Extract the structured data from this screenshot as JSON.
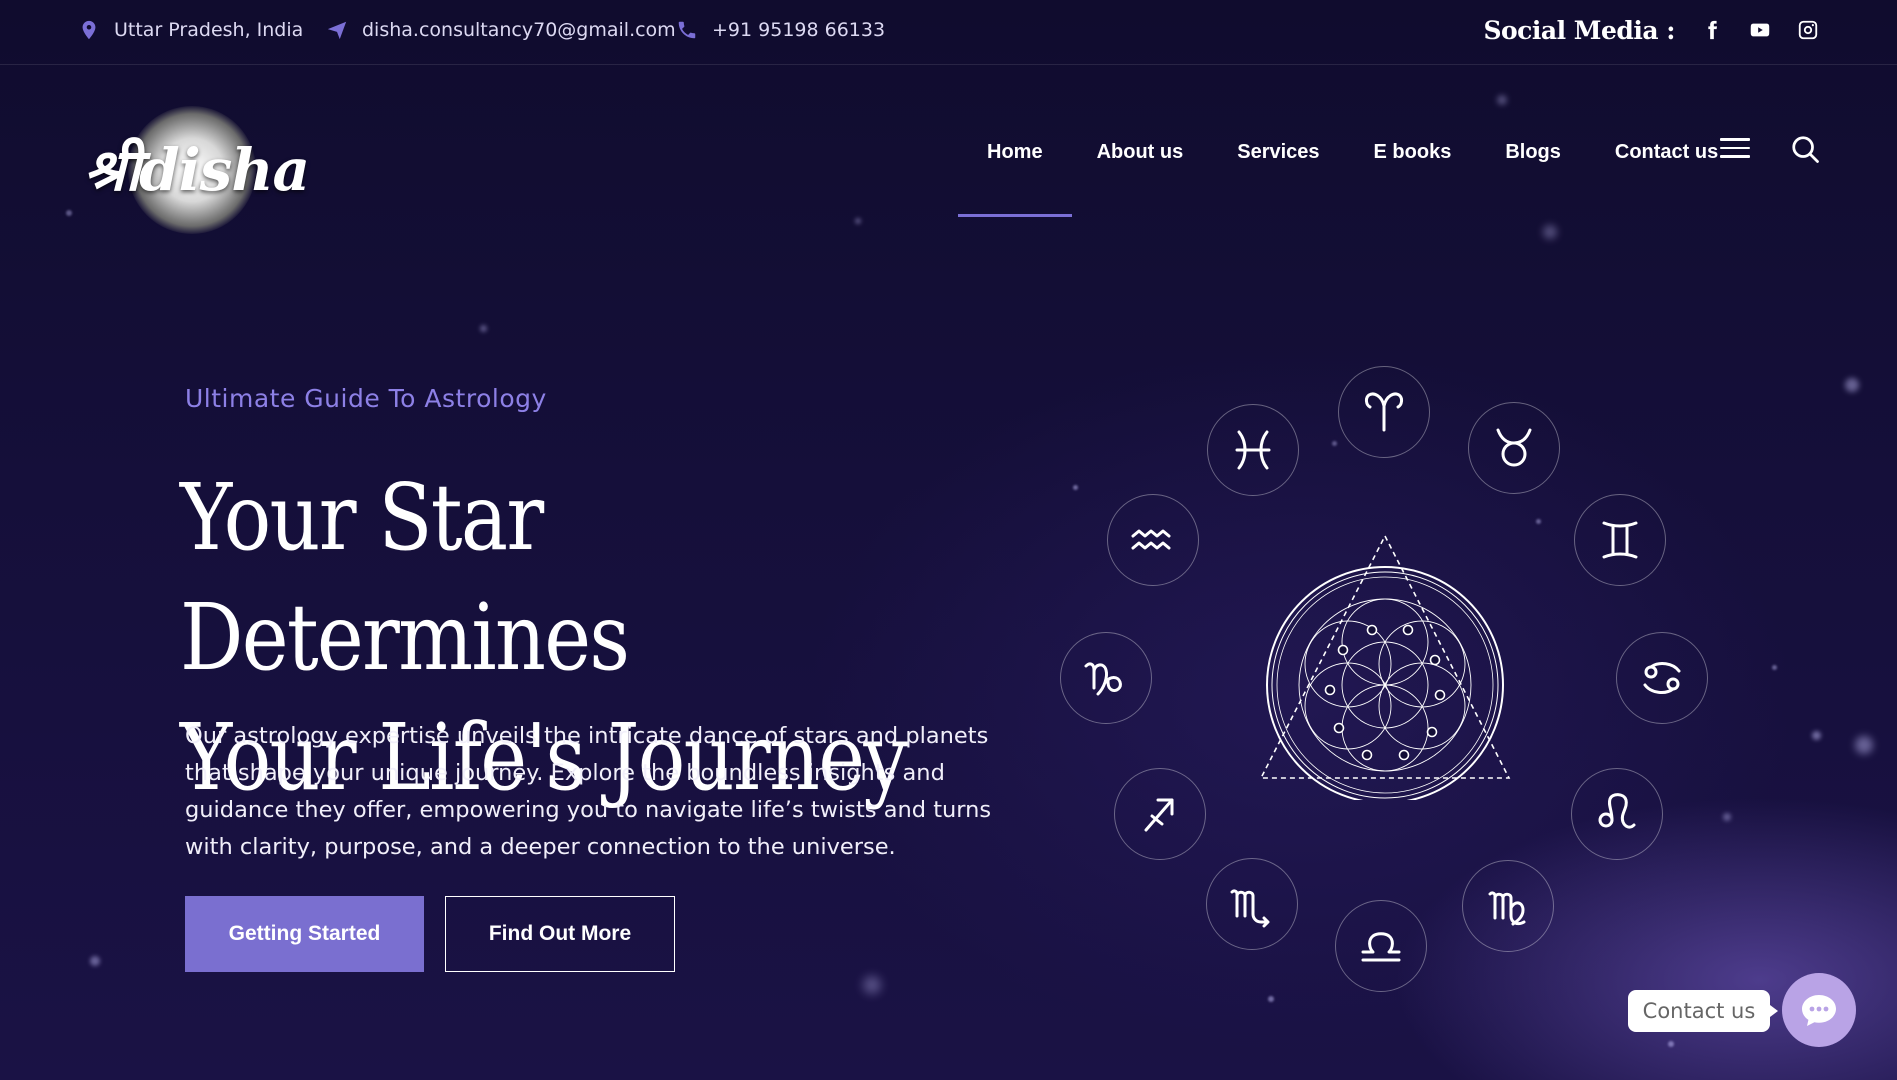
{
  "topbar": {
    "location": "Uttar Pradesh, India",
    "email": "disha.consultancy70@gmail.com",
    "phone": "+91 95198 66133",
    "social_label": "Social Media :",
    "social_icons": [
      "facebook-icon",
      "youtube-icon",
      "instagram-icon"
    ]
  },
  "logo": {
    "text": "श्रीdisha"
  },
  "nav": {
    "items": [
      {
        "label": "Home",
        "active": true
      },
      {
        "label": "About us"
      },
      {
        "label": "Services"
      },
      {
        "label": "E books"
      },
      {
        "label": "Blogs"
      },
      {
        "label": "Contact us"
      }
    ]
  },
  "hero": {
    "eyebrow": "Ultimate Guide To Astrology",
    "headline_line1": "Your Star Determines",
    "headline_line2": "Your Life's Journey",
    "body": "Our astrology expertise unveils the intricate dance of stars and planets that shape your unique journey. Explore the boundless insights and guidance they offer, empowering you to navigate life’s twists and turns with clarity, purpose, and a deeper connection to the universe.",
    "primary_button": "Getting Started",
    "secondary_button": "Find Out More"
  },
  "zodiac": [
    "aries",
    "taurus",
    "gemini",
    "cancer",
    "leo",
    "virgo",
    "libra",
    "scorpio",
    "sagittarius",
    "capricorn",
    "aquarius",
    "pisces"
  ],
  "chat": {
    "label": "Contact us"
  },
  "colors": {
    "accent": "#7b6fd6",
    "button": "#7a6fd0",
    "background": "#130e36",
    "chat": "#b9a3e6"
  }
}
